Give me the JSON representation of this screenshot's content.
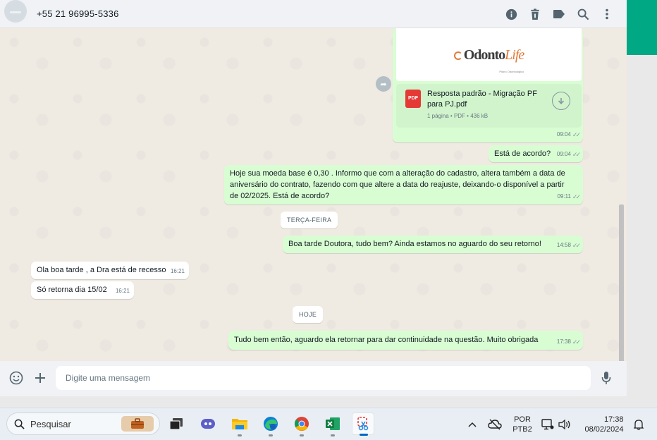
{
  "header": {
    "contact_name": "+55 21 96995-5336",
    "icons": [
      "info-icon",
      "trash-icon",
      "label-icon",
      "search-icon",
      "more-vertical-icon"
    ]
  },
  "messages": {
    "document": {
      "logo_text_a": "Odonto",
      "logo_text_b": "Life",
      "logo_sub": "Plano Odontológico",
      "file_icon_label": "PDF",
      "file_name": "Resposta padrão - Migração PF para PJ.pdf",
      "file_meta": "1 página • PDF • 436 kB",
      "time": "09:04"
    },
    "m1": {
      "text": "Está de acordo?",
      "time": "09:04"
    },
    "m2": {
      "text": "Hoje sua moeda base é 0,30 . Informo que com a alteração do cadastro, altera também a data de aniversário do contrato, fazendo com que altere a data do reajuste, deixando-o disponível a partir de 02/2025. Está de acordo?",
      "time": "09:11"
    },
    "date1": "TERÇA-FEIRA",
    "m3": {
      "text": "Boa tarde Doutora, tudo bem? Ainda estamos no aguardo do seu retorno!",
      "time": "14:58"
    },
    "m4": {
      "text": "Ola boa tarde , a Dra está de recesso",
      "time": "16:21"
    },
    "m5": {
      "text": "Só retorna dia  15/02",
      "time": "16:21"
    },
    "date2": "HOJE",
    "m6": {
      "text": "Tudo bem então, aguardo ela retornar para dar continuidade na questão. Muito obrigada",
      "time": "17:38"
    }
  },
  "composer": {
    "placeholder": "Digite uma mensagem"
  },
  "taskbar": {
    "search_placeholder": "Pesquisar",
    "lang_line1": "POR",
    "lang_line2": "PTB2",
    "clock_time": "17:38",
    "clock_date": "08/02/2024"
  },
  "colors": {
    "outgoing_bubble": "#d9fdd3",
    "incoming_bubble": "#ffffff",
    "accent": "#00a884",
    "pdf_red": "#e53935"
  }
}
